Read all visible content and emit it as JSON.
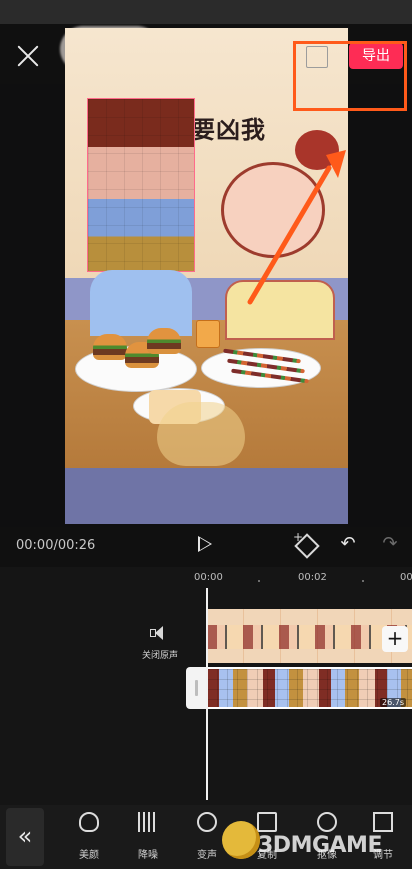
{
  "top_bar": {
    "export_label": "导出",
    "close_icon": "close-icon",
    "fullscreen_icon": "fullscreen-icon"
  },
  "preview": {
    "artwork_text": "要凶我"
  },
  "player": {
    "timecode": "00:00/00:26",
    "play_icon": "play-icon",
    "keyframe_icon": "keyframe-icon",
    "undo_icon": "undo-icon",
    "redo_icon": "redo-icon"
  },
  "timeline": {
    "ruler": [
      "00:00",
      "00:02",
      "00"
    ],
    "mute_label": "关闭原声",
    "duration": "26.7s",
    "add_clip_label": "+"
  },
  "toolbar": {
    "collapse_label": "«",
    "tools": [
      {
        "label": "美颜",
        "icon": "beauty-icon"
      },
      {
        "label": "降噪",
        "icon": "denoise-icon"
      },
      {
        "label": "变声",
        "icon": "voice-change-icon"
      },
      {
        "label": "复制",
        "icon": "copy-icon"
      },
      {
        "label": "抠像",
        "icon": "cutout-icon"
      },
      {
        "label": "调节",
        "icon": "adjust-icon"
      }
    ]
  },
  "watermark": {
    "text": "3DMGAME"
  },
  "colors": {
    "accent": "#fe2c55",
    "annotation": "#ff5a1a",
    "background": "#0f0f10"
  }
}
